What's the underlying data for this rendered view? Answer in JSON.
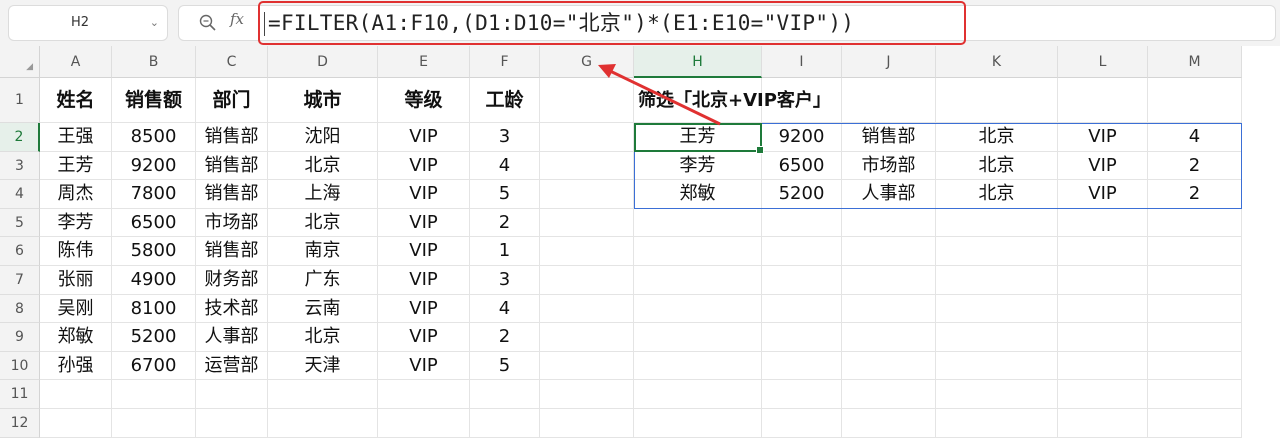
{
  "name_box": {
    "value": "H2"
  },
  "formula": {
    "text": "=FILTER(A1:F10,(D1:D10=\"北京\")*(E1:E10=\"VIP\"))"
  },
  "columns": [
    "A",
    "B",
    "C",
    "D",
    "E",
    "F",
    "G",
    "H",
    "I",
    "J",
    "K",
    "L",
    "M"
  ],
  "rows": [
    "1",
    "2",
    "3",
    "4",
    "5",
    "6",
    "7",
    "8",
    "9",
    "10",
    "11",
    "12"
  ],
  "source_table": {
    "headers": [
      "姓名",
      "销售额",
      "部门",
      "城市",
      "等级",
      "工龄"
    ],
    "rows": [
      [
        "王强",
        "8500",
        "销售部",
        "沈阳",
        "VIP",
        "3"
      ],
      [
        "王芳",
        "9200",
        "销售部",
        "北京",
        "VIP",
        "4"
      ],
      [
        "周杰",
        "7800",
        "销售部",
        "上海",
        "VIP",
        "5"
      ],
      [
        "李芳",
        "6500",
        "市场部",
        "北京",
        "VIP",
        "2"
      ],
      [
        "陈伟",
        "5800",
        "销售部",
        "南京",
        "VIP",
        "1"
      ],
      [
        "张丽",
        "4900",
        "财务部",
        "广东",
        "VIP",
        "3"
      ],
      [
        "吴刚",
        "8100",
        "技术部",
        "云南",
        "VIP",
        "4"
      ],
      [
        "郑敏",
        "5200",
        "人事部",
        "北京",
        "VIP",
        "2"
      ],
      [
        "孙强",
        "6700",
        "运营部",
        "天津",
        "VIP",
        "5"
      ]
    ]
  },
  "result": {
    "title": "筛选「北京+VIP客户」",
    "rows": [
      [
        "王芳",
        "9200",
        "销售部",
        "北京",
        "VIP",
        "4"
      ],
      [
        "李芳",
        "6500",
        "市场部",
        "北京",
        "VIP",
        "2"
      ],
      [
        "郑敏",
        "5200",
        "人事部",
        "北京",
        "VIP",
        "2"
      ]
    ]
  },
  "colors": {
    "accent_green": "#1e7a3a",
    "annotation_red": "#e03131",
    "spill_blue": "#3b6fd6"
  }
}
